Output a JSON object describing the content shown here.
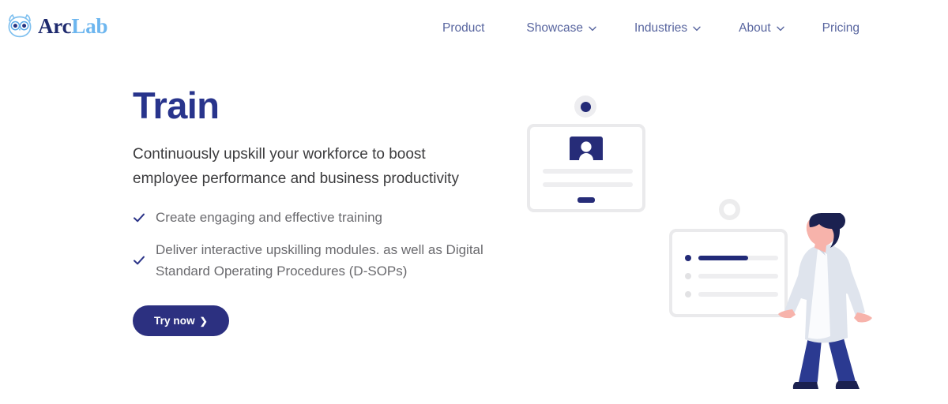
{
  "brand": {
    "logo_icon": "owl-icon",
    "name_part_1": "Arc",
    "name_part_2": "Lab",
    "color_dark": "#1e2a6e",
    "color_light": "#6db6ef"
  },
  "nav": {
    "items": [
      {
        "label": "Product",
        "has_dropdown": false,
        "icon": ""
      },
      {
        "label": "Showcase",
        "has_dropdown": true,
        "icon": "chevron-down-icon"
      },
      {
        "label": "Industries",
        "has_dropdown": true,
        "icon": "chevron-down-icon"
      },
      {
        "label": "About",
        "has_dropdown": true,
        "icon": "chevron-down-icon"
      },
      {
        "label": "Pricing",
        "has_dropdown": false,
        "icon": ""
      }
    ],
    "color": "#58659f"
  },
  "hero": {
    "headline": "Train",
    "headline_color": "#28348c",
    "subheadline": "Continuously upskill your workforce to boost employee performance and business productivity",
    "bullets": [
      {
        "icon": "check-icon",
        "text": "Create engaging and effective training"
      },
      {
        "icon": "check-icon",
        "text": "Deliver interactive upskilling modules. as well as Digital Standard Operating Procedures (D-SOPs)"
      }
    ],
    "cta": {
      "label": "Try now",
      "arrow": "❯",
      "background": "#2c3080",
      "text_color": "#ffffff"
    }
  },
  "illustration": {
    "top_dot": {
      "icon": "status-dot-icon",
      "color": "#232a77",
      "ring_color": "#ededf0"
    },
    "ring": {
      "icon": "circle-outline-icon",
      "color": "#ececed"
    },
    "card_profile": {
      "icon": "profile-badge-icon",
      "badge_color": "#262c78",
      "line_color": "#eeeef0",
      "dash_color": "#262c78",
      "border_color": "#eaeaec"
    },
    "card_checklist": {
      "border_color": "#eaeaec",
      "rows": [
        {
          "dot": "on",
          "fill_percent": 62
        },
        {
          "dot": "off",
          "fill_percent": 0
        },
        {
          "dot": "off",
          "fill_percent": 0
        }
      ],
      "active_color": "#212a78",
      "track_color": "#eeeef0"
    },
    "person": {
      "icon": "walking-person-illustration",
      "hair_color": "#1b2150",
      "skin_color": "#f7b3ab",
      "coat_color": "#dfe4ed",
      "shirt_color": "#3a3a42",
      "pants_color": "#2b3a91",
      "shoe_color": "#1b2150"
    }
  }
}
